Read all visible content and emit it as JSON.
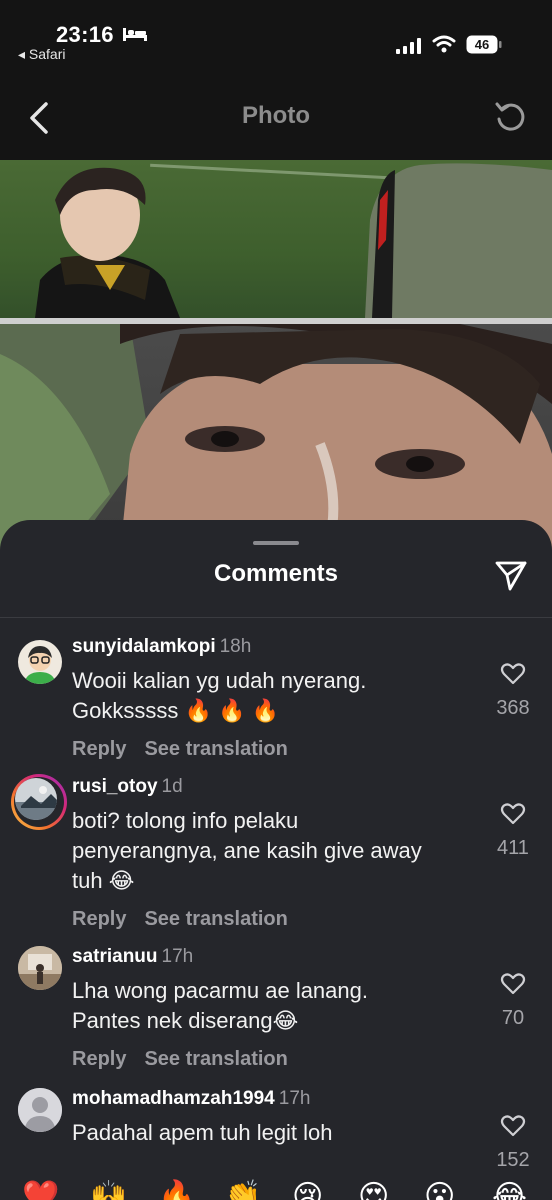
{
  "status_bar": {
    "time": "23:16",
    "back_app": "◂ Safari",
    "battery": "46"
  },
  "header": {
    "title": "Photo"
  },
  "sheet": {
    "title": "Comments"
  },
  "comments": [
    {
      "username": "sunyidalamkopi",
      "time": "18h",
      "text_line1": "Wooii kalian yg udah nyerang.",
      "text_line2": "Gokksssss 🔥 🔥 🔥",
      "reply": "Reply",
      "translate": "See translation",
      "likes": "368"
    },
    {
      "username": "rusi_otoy",
      "time": "1d",
      "text_line1": "boti? tolong info pelaku",
      "text_line2": "penyerangnya, ane kasih give away",
      "text_line3": "tuh 😂",
      "reply": "Reply",
      "translate": "See translation",
      "likes": "411"
    },
    {
      "username": "satrianuu",
      "time": "17h",
      "text_line1": "Lha wong pacarmu ae lanang.",
      "text_line2": "Pantes nek diserang😂",
      "reply": "Reply",
      "translate": "See translation",
      "likes": "70"
    },
    {
      "username": "mohamadhamzah1994",
      "time": "17h",
      "text_line1": "Padahal apem tuh legit loh",
      "likes": "152"
    }
  ],
  "reactions": [
    "❤️",
    "🙌",
    "🔥",
    "👏",
    "😢",
    "😍",
    "😮",
    "😂"
  ],
  "colors": {
    "background": "#141414",
    "sheet": "#25262b",
    "muted_text": "#9a9a9f"
  }
}
